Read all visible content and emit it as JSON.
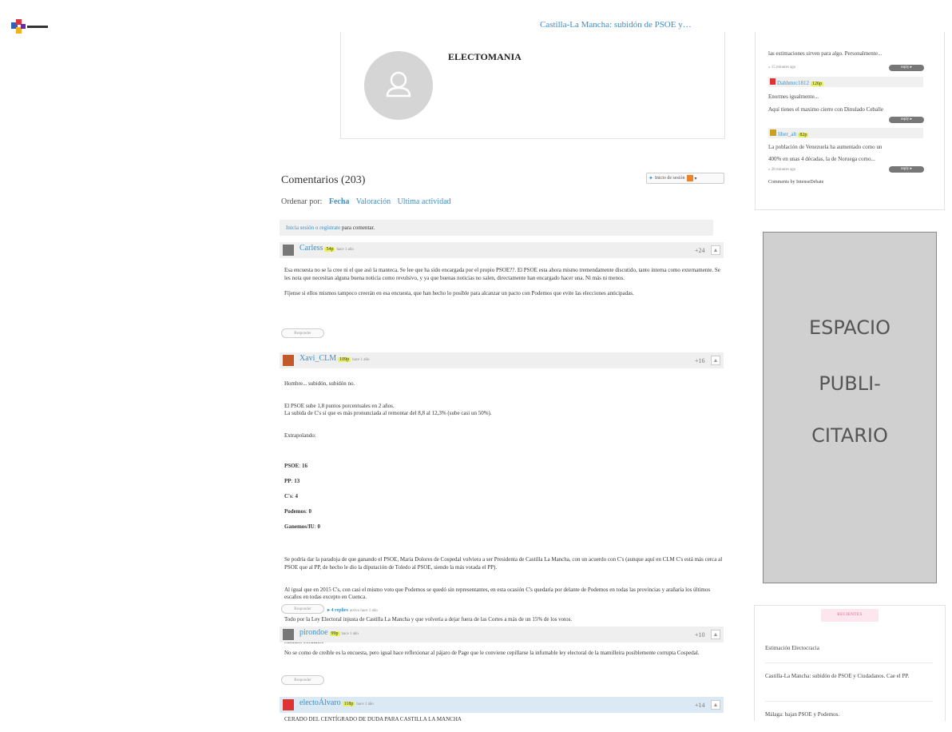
{
  "header": {
    "title": "Castilla-La Mancha: subidón de PSOE y…"
  },
  "author": {
    "name": "ELECTOMANIA"
  },
  "comments_section": {
    "title": "Comentarios (203)",
    "login_widget": "Inicio de sesión",
    "order_by_label": "Ordenar por:",
    "sort_options": [
      "Fecha",
      "Valoración",
      "Ultima actividad"
    ],
    "login_prompt_link": "Inicia sesión o regístrate",
    "login_prompt_rest": " para comentar.",
    "reply_label": "Responder",
    "comments": [
      {
        "user": "Carless",
        "points": "54p",
        "time": "hace 1 año",
        "votes": "+24",
        "paragraphs": [
          "Esa encuesta no se la cree ni el que asó la manteca. Se lee que ha sido encargada por el propio PSOE??. El PSOE esta ahora mismo tremendamente discutido, tanto interna como externamente. Se les nota que necesitan alguna buena noticia como revulsivo, y ya que buenas noticias no salen, directamente han encargado hacer una. Ni más ni menos.",
          "Fíjense si ellos mismos tampoco creerán en esa encuesta, que han hecho lo posible para alcanzar un pacto con Podemos que evite las elecciones anticipadas."
        ]
      },
      {
        "user": "Xavi_CLM",
        "points": "109p",
        "time": "hace 1 año",
        "votes": "+16",
        "paragraphs": [
          "Hombre... subidón, subidón no.",
          "El PSOE sube 1,8 puntos porcentuales en 2 años.\nLa subida de C's sí que es más pronunciada al remontar del 8,8 al 12,3% (sube casi un 50%).",
          "Extrapolando:",
          "Se podría dar la paradoja de que ganando el PSOE, María Dolores de Cospedal volviera a ser Presidenta de Castilla La Mancha, con un acuerdo con C's (aunque aquí en CLM C's está más cerca al PSOE que al PP, de hecho le dio la diputación de Toledo al PSOE, siendo la más votada el PP).",
          "Al igual que en 2015 C's, con casi el mismo voto que Podemos se quedó sin representantes, en esta ocasión C's quedaría por delante de Podemos en todas las provincias y arañaría los últimos escaños en todas excepto en Cuenca.",
          "Todo por la Ley Electoral injusta de Castilla La Mancha y que volvería a dejar fuera de las Cortes a más de un 15% de los votos.",
          "Saludos cordiales"
        ],
        "seats": [
          {
            "party": "PSOE",
            "value": "16"
          },
          {
            "party": "PP",
            "value": "13"
          },
          {
            "party": "C's",
            "value": "4"
          },
          {
            "party": "Podemos",
            "value": "0"
          },
          {
            "party": "Ganemos/IU",
            "value": "0"
          }
        ],
        "replies": "▸ 4 replies",
        "replies_time": "activo hace 1 año"
      },
      {
        "user": "pirondoe",
        "points": "99p",
        "time": "hace 1 año",
        "votes": "+10",
        "paragraphs": [
          "No se como de creíble es la encuesta, pero igual hace reflexionar al pájaro de Page que le conviene cepillarse la infumable ley electoral de la mamilleira posiblemente corrupta Cospedal."
        ]
      },
      {
        "user": "electoÁlvaro",
        "points": "118p",
        "time": "hace 1 año",
        "votes": "+14",
        "paragraphs": [
          "CERADO DEL CENTÍGRADO DE DUDA PARA CASTILLA LA MANCHA"
        ]
      }
    ]
  },
  "recent_comments": {
    "items": [
      {
        "text": "las estimaciones sirven para algo. Personalmente...",
        "time": "» 15 minutes ago"
      },
      {
        "user": "Dahhmrc1812",
        "points": "126p",
        "lines": [
          "Enormes igualmente...",
          "Aquí tienes el maximo cierre con Dinulado Ceballe"
        ]
      },
      {
        "user": "liber_alt",
        "points": "82p",
        "lines": [
          "La población de Venezuela ha aumentado como un",
          "400% en unas 4 décadas, la de Noruega como..."
        ],
        "time": "» 28 minutes ago"
      }
    ],
    "reply_label": "reply ▸",
    "footer": "Comments by IntenseDebate"
  },
  "ad": {
    "lines": [
      "ESPACIO",
      "PUBLI-",
      "CITARIO"
    ]
  },
  "recientes": {
    "tab": "RECIENTES",
    "items": [
      "Estimación Electocracia",
      "Castilla-La Mancha: subidón de PSOE y Ciudadanos. Cae el PP.",
      "Málaga: bajan PSOE y Podemos."
    ]
  },
  "colors": {
    "link": "#3a8fc9",
    "points_badge": "#e8f05a",
    "ad_background": "#d0d0d0"
  }
}
